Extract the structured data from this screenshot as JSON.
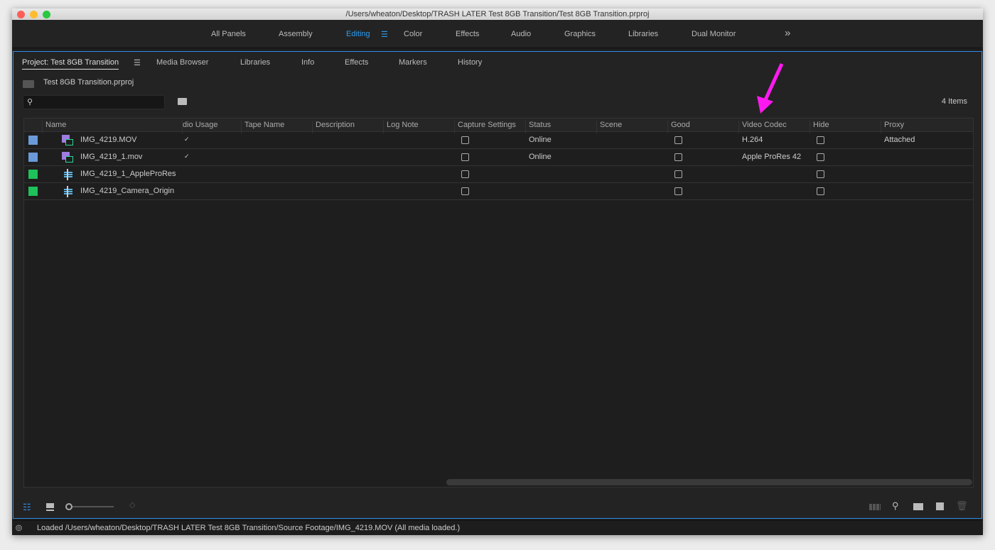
{
  "window": {
    "title": "/Users/wheaton/Desktop/TRASH LATER Test 8GB Transition/Test 8GB Transition.prproj"
  },
  "workspaces": {
    "items": [
      "All Panels",
      "Assembly",
      "Editing",
      "Color",
      "Effects",
      "Audio",
      "Graphics",
      "Libraries",
      "Dual Monitor"
    ],
    "active": "Editing",
    "overflow": "»"
  },
  "tabs": [
    "Project: Test 8GB Transition",
    "Media Browser",
    "Libraries",
    "Info",
    "Effects",
    "Markers",
    "History"
  ],
  "project": {
    "file": "Test 8GB Transition.prproj",
    "search_placeholder": "",
    "item_count": "4 Items"
  },
  "columns": [
    "Name",
    "dio Usage",
    "Tape Name",
    "Description",
    "Log Note",
    "Capture Settings",
    "Status",
    "Scene",
    "Good",
    "Video Codec",
    "Hide",
    "Proxy"
  ],
  "rows": [
    {
      "label_color": "#6a9bd8",
      "type": "clip",
      "name": "IMG_4219.MOV",
      "audio_usage": "✓",
      "status": "Online",
      "codec": "H.264",
      "proxy": "Attached"
    },
    {
      "label_color": "#6a9bd8",
      "type": "clip",
      "name": "IMG_4219_1.mov",
      "audio_usage": "✓",
      "status": "Online",
      "codec": "Apple ProRes 42",
      "proxy": ""
    },
    {
      "label_color": "#1ec15a",
      "type": "sequence",
      "name": "IMG_4219_1_AppleProRes",
      "audio_usage": "",
      "status": "",
      "codec": "",
      "proxy": ""
    },
    {
      "label_color": "#1ec15a",
      "type": "sequence",
      "name": "IMG_4219_Camera_Origin",
      "audio_usage": "",
      "status": "",
      "codec": "",
      "proxy": ""
    }
  ],
  "annotation": {
    "arrow_color": "#ff19f0"
  },
  "status_bar": {
    "text": "Loaded  /Users/wheaton/Desktop/TRASH LATER Test 8GB Transition/Source Footage/IMG_4219.MOV (All media loaded.)"
  },
  "colors": {
    "accent": "#2d8ceb"
  }
}
